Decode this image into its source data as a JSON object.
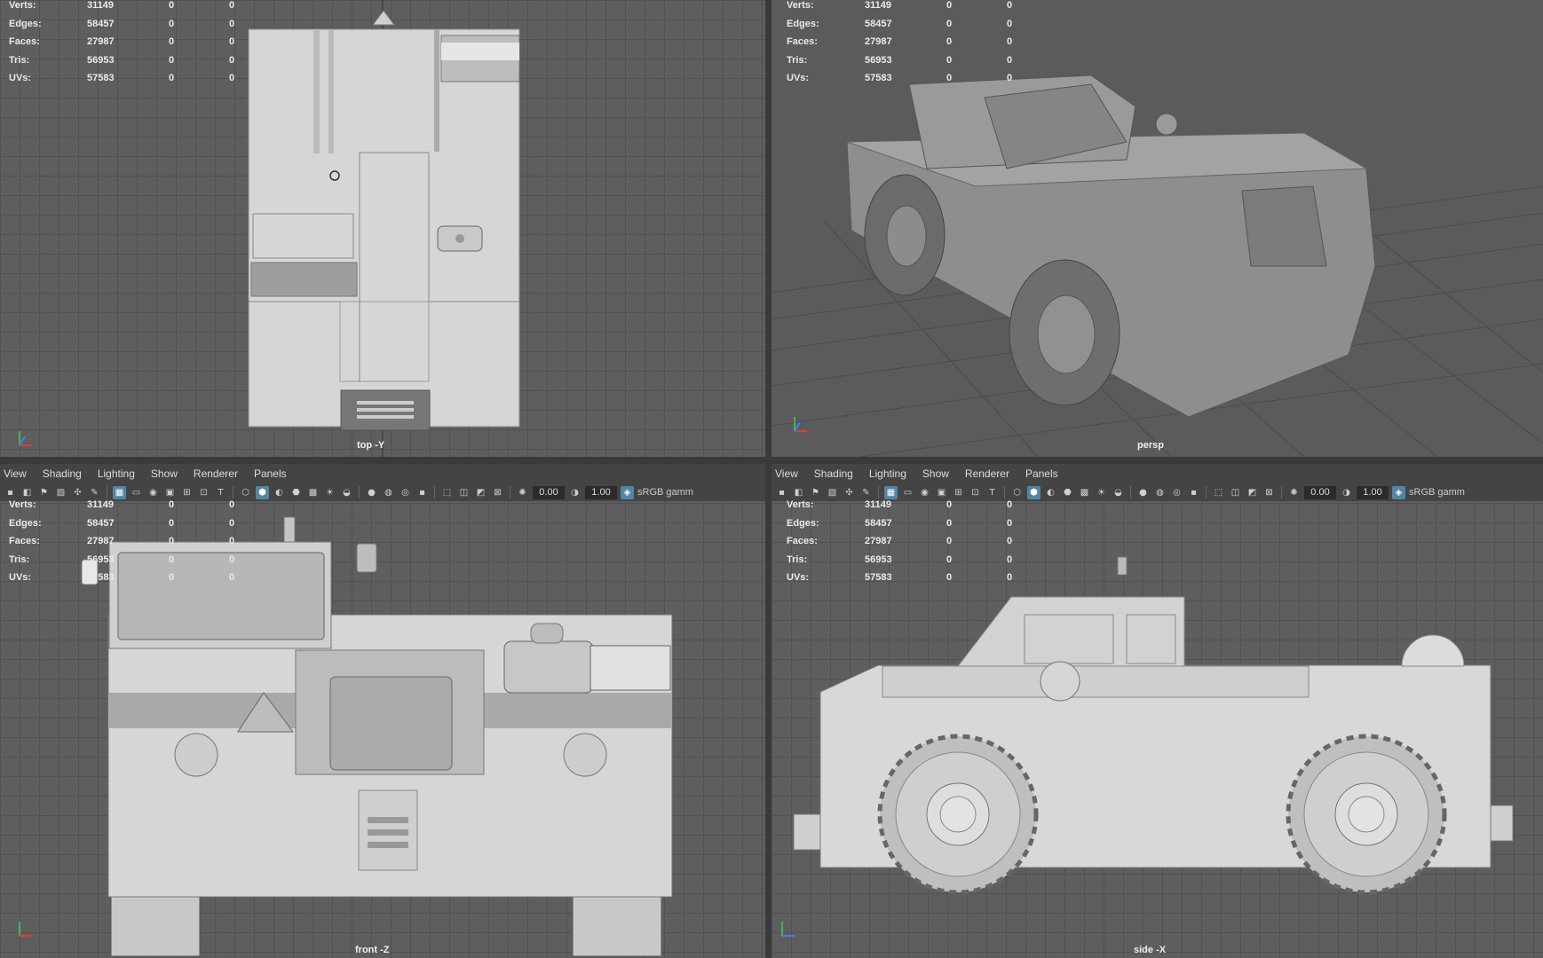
{
  "menu": [
    "View",
    "Shading",
    "Lighting",
    "Show",
    "Renderer",
    "Panels"
  ],
  "toolbar": {
    "field1": "0.00",
    "field2": "1.00",
    "color_space": "sRGB gamm"
  },
  "hud": {
    "rows": [
      {
        "label": "Verts:",
        "v1": "31149",
        "v2": "0",
        "v3": "0"
      },
      {
        "label": "Edges:",
        "v1": "58457",
        "v2": "0",
        "v3": "0"
      },
      {
        "label": "Faces:",
        "v1": "27987",
        "v2": "0",
        "v3": "0"
      },
      {
        "label": "Tris:",
        "v1": "56953",
        "v2": "0",
        "v3": "0"
      },
      {
        "label": "UVs:",
        "v1": "57583",
        "v2": "0",
        "v3": "0"
      }
    ]
  },
  "viewports": {
    "top": {
      "camera": "top -Y"
    },
    "persp": {
      "camera": "persp"
    },
    "front": {
      "camera": "front -Z"
    },
    "side": {
      "camera": "side -X"
    }
  },
  "colors": {
    "accent": "#5285a6",
    "viewport_bg": "#5e5e5e",
    "panel_bg": "#444444",
    "model": "#d4d4d4"
  }
}
